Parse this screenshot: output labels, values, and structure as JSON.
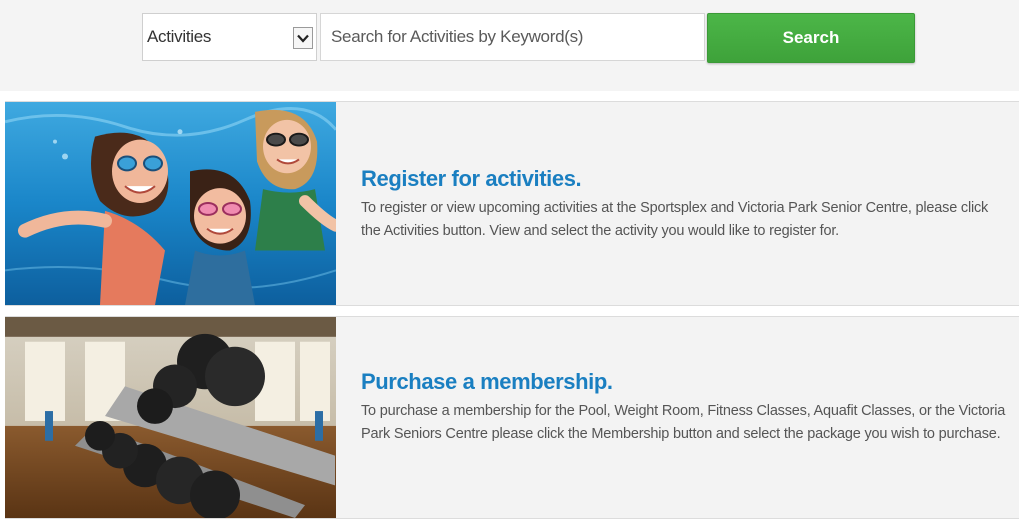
{
  "search": {
    "category_value": "Activities",
    "placeholder": "Search for Activities by Keyword(s)",
    "button_label": "Search",
    "button_color": "#43ac3f"
  },
  "cards": [
    {
      "title": "Register for activities.",
      "description": "To register or view upcoming activities at the Sportsplex and Victoria Park Senior Centre, please click the Activities button. View and select the activity you would like to register for.",
      "image": "kids-swimming-underwater-photo"
    },
    {
      "title": "Purchase a membership.",
      "description": "To purchase a membership for the Pool, Weight Room, Fitness Classes, Aquafit Classes, or the Victoria Park Seniors Centre please click the Membership button and select the package you wish to purchase.",
      "image": "gym-dumbbell-rack-photo"
    }
  ],
  "colors": {
    "title_blue": "#1a7fc1",
    "search_green": "#43ac3f",
    "card_background": "#f3f3f3"
  }
}
